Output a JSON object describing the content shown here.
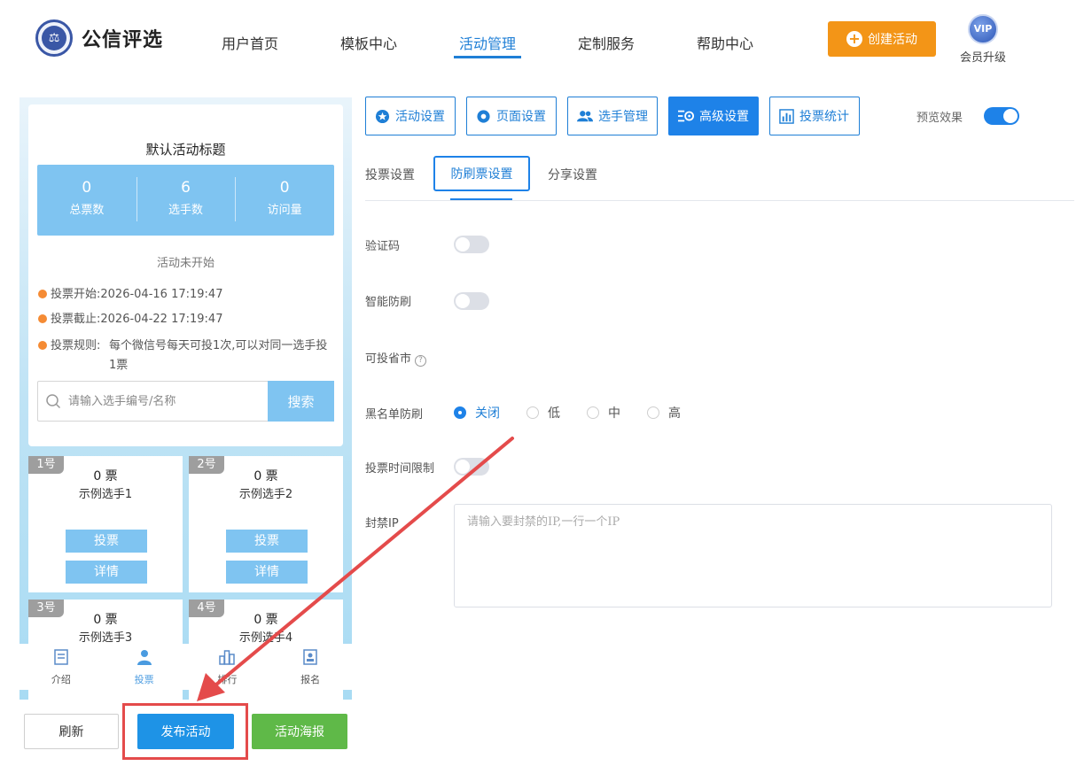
{
  "brand": {
    "name": "公信评选"
  },
  "nav": {
    "items": [
      "用户首页",
      "模板中心",
      "活动管理",
      "定制服务",
      "帮助中心"
    ],
    "create_label": "创建活动",
    "vip_badge": "VIP",
    "vip_label": "会员升级"
  },
  "preview": {
    "title": "默认活动标题",
    "stats": [
      {
        "value": "0",
        "label": "总票数"
      },
      {
        "value": "6",
        "label": "选手数"
      },
      {
        "value": "0",
        "label": "访问量"
      }
    ],
    "status": "活动未开始",
    "vote_start_label": "投票开始:",
    "vote_start": "2026-04-16 17:19:47",
    "vote_end_label": "投票截止:",
    "vote_end": "2026-04-22 17:19:47",
    "rule_label": "投票规则:",
    "rule_text": "每个微信号每天可投1次,可以对同一选手投1票",
    "search_placeholder": "请输入选手编号/名称",
    "search_btn": "搜索",
    "vote_btn": "投票",
    "detail_btn": "详情",
    "players": [
      {
        "tag": "1号",
        "votes": "0 票",
        "name": "示例选手1"
      },
      {
        "tag": "2号",
        "votes": "0 票",
        "name": "示例选手2"
      },
      {
        "tag": "3号",
        "votes": "0 票",
        "name": "示例选手3"
      },
      {
        "tag": "4号",
        "votes": "0 票",
        "name": "示例选手4"
      }
    ],
    "tabs": [
      "介绍",
      "投票",
      "排行",
      "报名"
    ]
  },
  "actions": {
    "refresh": "刷新",
    "publish": "发布活动",
    "poster": "活动海报"
  },
  "toolbar": {
    "items": [
      "活动设置",
      "页面设置",
      "选手管理",
      "高级设置",
      "投票统计"
    ],
    "preview_label": "预览效果"
  },
  "subtabs": [
    "投票设置",
    "防刷票设置",
    "分享设置"
  ],
  "form": {
    "captcha": "验证码",
    "smart": "智能防刷",
    "region": "可投省市",
    "help": "?",
    "blacklist": "黑名单防刷",
    "levels": [
      "关闭",
      "低",
      "中",
      "高"
    ],
    "time_limit": "投票时间限制",
    "ban_ip": "封禁IP",
    "ban_ip_placeholder": "请输入要封禁的IP,一行一个IP"
  },
  "colors": {
    "primary": "#1e82e8",
    "orange": "#f39517",
    "green": "#5fb948",
    "highlight": "#e44b4b"
  }
}
